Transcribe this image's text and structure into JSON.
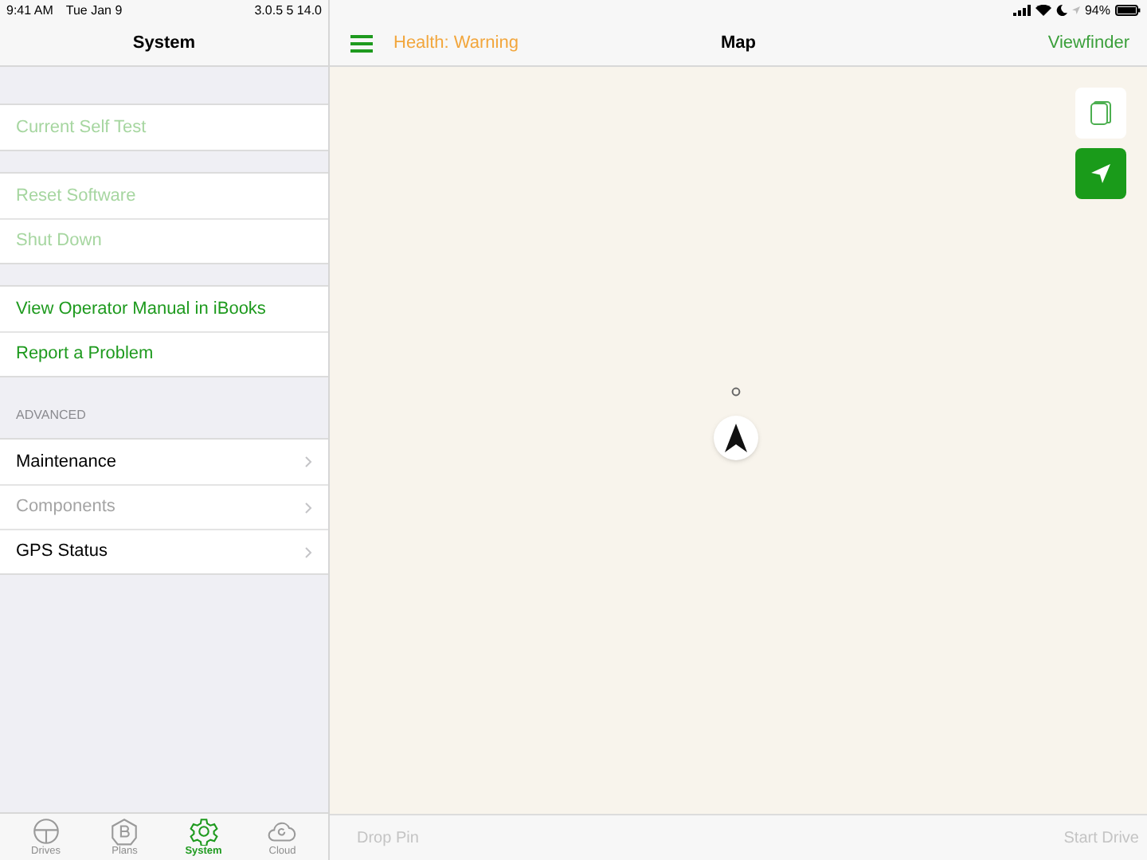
{
  "status_bar": {
    "time": "9:41 AM",
    "date": "Tue Jan 9",
    "version": "3.0.5 5 14.0",
    "battery": "94%"
  },
  "sidebar": {
    "title": "System",
    "groups": [
      {
        "items": [
          {
            "label": "Current Self Test",
            "disabled": true,
            "chevron": false
          }
        ]
      },
      {
        "items": [
          {
            "label": "Reset Software",
            "disabled": true,
            "chevron": false
          },
          {
            "label": "Shut Down",
            "disabled": true,
            "chevron": false
          }
        ]
      },
      {
        "items": [
          {
            "label": "View Operator Manual in iBooks",
            "disabled": false,
            "chevron": false
          },
          {
            "label": "Report a Problem",
            "disabled": false,
            "chevron": false
          }
        ]
      },
      {
        "header": "ADVANCED",
        "items": [
          {
            "label": "Maintenance",
            "disabled": false,
            "chevron": true
          },
          {
            "label": "Components",
            "disabled": true,
            "chevron": true
          },
          {
            "label": "GPS Status",
            "disabled": false,
            "chevron": true
          }
        ]
      }
    ],
    "tabs": [
      {
        "label": "Drives",
        "kind": "wheel",
        "selected": false
      },
      {
        "label": "Plans",
        "kind": "plans",
        "selected": false
      },
      {
        "label": "System",
        "kind": "gear",
        "selected": true
      },
      {
        "label": "Cloud",
        "kind": "cloud",
        "selected": false
      }
    ]
  },
  "map": {
    "health": "Health: Warning",
    "title": "Map",
    "right_action": "Viewfinder",
    "bottom_left": "Drop Pin",
    "bottom_right": "Start Drive"
  }
}
